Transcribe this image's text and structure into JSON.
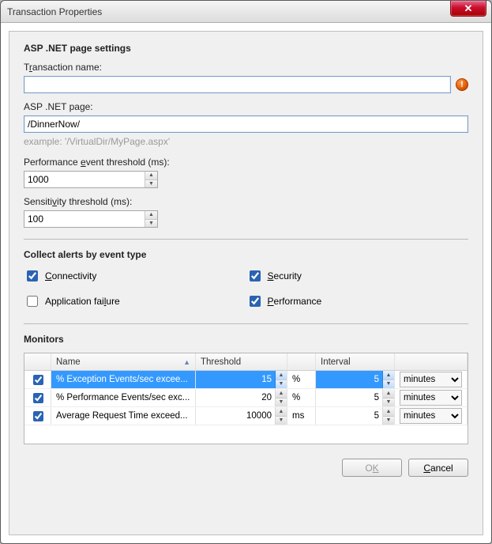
{
  "window": {
    "title": "Transaction Properties"
  },
  "sections": {
    "page_settings": "ASP .NET page settings",
    "collect_alerts": "Collect alerts by event type",
    "monitors": "Monitors"
  },
  "labels": {
    "transaction_name_pre": "T",
    "transaction_name_u": "r",
    "transaction_name_post": "ansaction name:",
    "asp_page_pre": "ASP .NET pa",
    "asp_page_u": "g",
    "asp_page_post": "e:",
    "asp_page_hint": "example: '/VirtualDir/MyPage.aspx'",
    "perf_thresh_pre": "Performance ",
    "perf_thresh_u": "e",
    "perf_thresh_post": "vent threshold (ms):",
    "sens_thresh_pre": "Sensiti",
    "sens_thresh_u": "v",
    "sens_thresh_post": "ity threshold (ms):"
  },
  "values": {
    "transaction_name": "",
    "asp_page": "/DinnerNow/",
    "perf_threshold": "1000",
    "sens_threshold": "100"
  },
  "alerts": {
    "connectivity": {
      "label_u": "C",
      "label_post": "onnectivity",
      "checked": true
    },
    "security": {
      "label_u": "S",
      "label_post": "ecurity",
      "checked": true
    },
    "app_failure": {
      "label_pre": "Application fai",
      "label_u": "l",
      "label_post": "ure",
      "checked": false
    },
    "performance": {
      "label_u": "P",
      "label_post": "erformance",
      "checked": true
    }
  },
  "monitors_table": {
    "columns": {
      "name": "Name",
      "threshold": "Threshold",
      "interval": "Interval"
    },
    "rows": [
      {
        "checked": true,
        "name": "% Exception Events/sec excee...",
        "threshold": "15",
        "unit": "%",
        "interval": "5",
        "interval_unit": "minutes",
        "selected": true
      },
      {
        "checked": true,
        "name": "% Performance Events/sec exc...",
        "threshold": "20",
        "unit": "%",
        "interval": "5",
        "interval_unit": "minutes",
        "selected": false
      },
      {
        "checked": true,
        "name": "Average Request Time exceed...",
        "threshold": "10000",
        "unit": "ms",
        "interval": "5",
        "interval_unit": "minutes",
        "selected": false
      }
    ],
    "interval_unit_options": [
      "minutes"
    ]
  },
  "buttons": {
    "ok_pre": "O",
    "ok_u": "K",
    "cancel_u": "C",
    "cancel_post": "ancel"
  },
  "icons": {
    "error_glyph": "!",
    "close_glyph": "✕",
    "up": "▲",
    "down": "▼",
    "sort": "▲"
  }
}
